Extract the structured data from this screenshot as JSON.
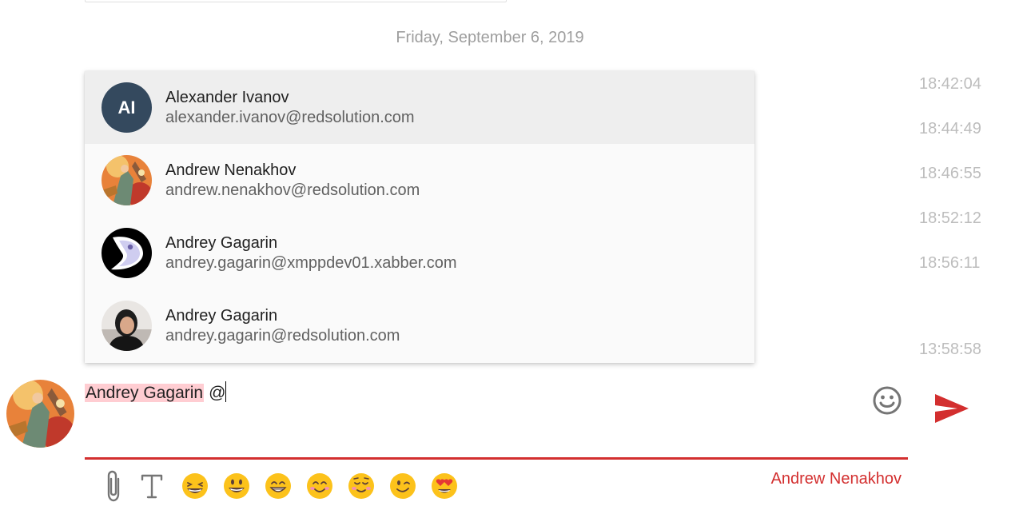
{
  "chat": {
    "date_divider": "Friday, September 6, 2019",
    "timestamps": [
      "18:42:04",
      "18:44:49",
      "18:46:55",
      "18:52:12",
      "18:56:11",
      "13:58:58"
    ]
  },
  "mention_list": {
    "items": [
      {
        "name": "Alexander Ivanov",
        "jid": "alexander.ivanov@redsolution.com",
        "initials": "AI",
        "avatar": "initials-avatar",
        "selected": true
      },
      {
        "name": "Andrew Nenakhov",
        "jid": "andrew.nenakhov@redsolution.com",
        "avatar": "illustrated-avatar"
      },
      {
        "name": "Andrey Gagarin",
        "jid": "andrey.gagarin@xmppdev01.xabber.com",
        "avatar": "logo-avatar"
      },
      {
        "name": "Andrey Gagarin",
        "jid": "andrey.gagarin@redsolution.com",
        "avatar": "photo-avatar"
      }
    ]
  },
  "composer": {
    "mention_text": "Andrey Gagarin",
    "typed_text": "@",
    "emoji_icon": "smiley-face-icon",
    "send_icon": "send-icon"
  },
  "toolbar": {
    "attach_icon": "paperclip-icon",
    "format_icon": "text-format-icon",
    "emojis": [
      "grinning-squinting",
      "grinning-big-eyes",
      "beaming",
      "smiling-eyes",
      "relieved-blush",
      "winking",
      "heart-eyes"
    ],
    "author": "Andrew Nenakhov"
  },
  "colors": {
    "accent": "#d32f2f",
    "mention_highlight": "#ffcdd2",
    "initials_avatar_bg": "#34495e",
    "selected_row": "#eeeeee"
  }
}
